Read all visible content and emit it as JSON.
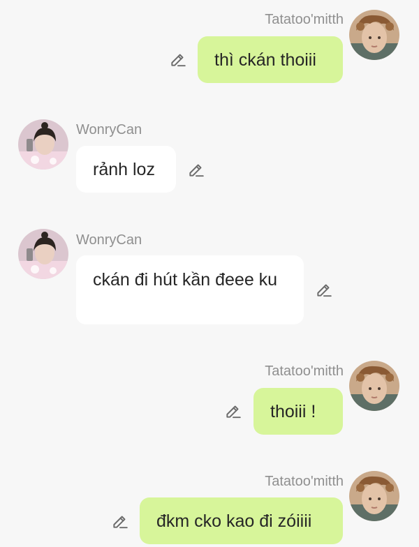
{
  "messages": [
    {
      "sender": "Tatatoo'mitth",
      "text": "thì ckán thoiii",
      "side": "right"
    },
    {
      "sender": "WonryCan",
      "text": "rảnh loz",
      "side": "left"
    },
    {
      "sender": "WonryCan",
      "text": "ckán đi hút kần đeee ku",
      "side": "left"
    },
    {
      "sender": "Tatatoo'mitth",
      "text": "thoiii !",
      "side": "right"
    },
    {
      "sender": "Tatatoo'mitth",
      "text": "đkm cko kao đi zóiiii",
      "side": "right"
    }
  ],
  "colors": {
    "background": "#f7f7f7",
    "my_bubble": "#d7f59a",
    "their_bubble": "#ffffff",
    "sender_name": "#8f8f8f",
    "text": "#262626",
    "icon": "#6b6b6b"
  },
  "icons": {
    "edit": "pencil-icon"
  }
}
